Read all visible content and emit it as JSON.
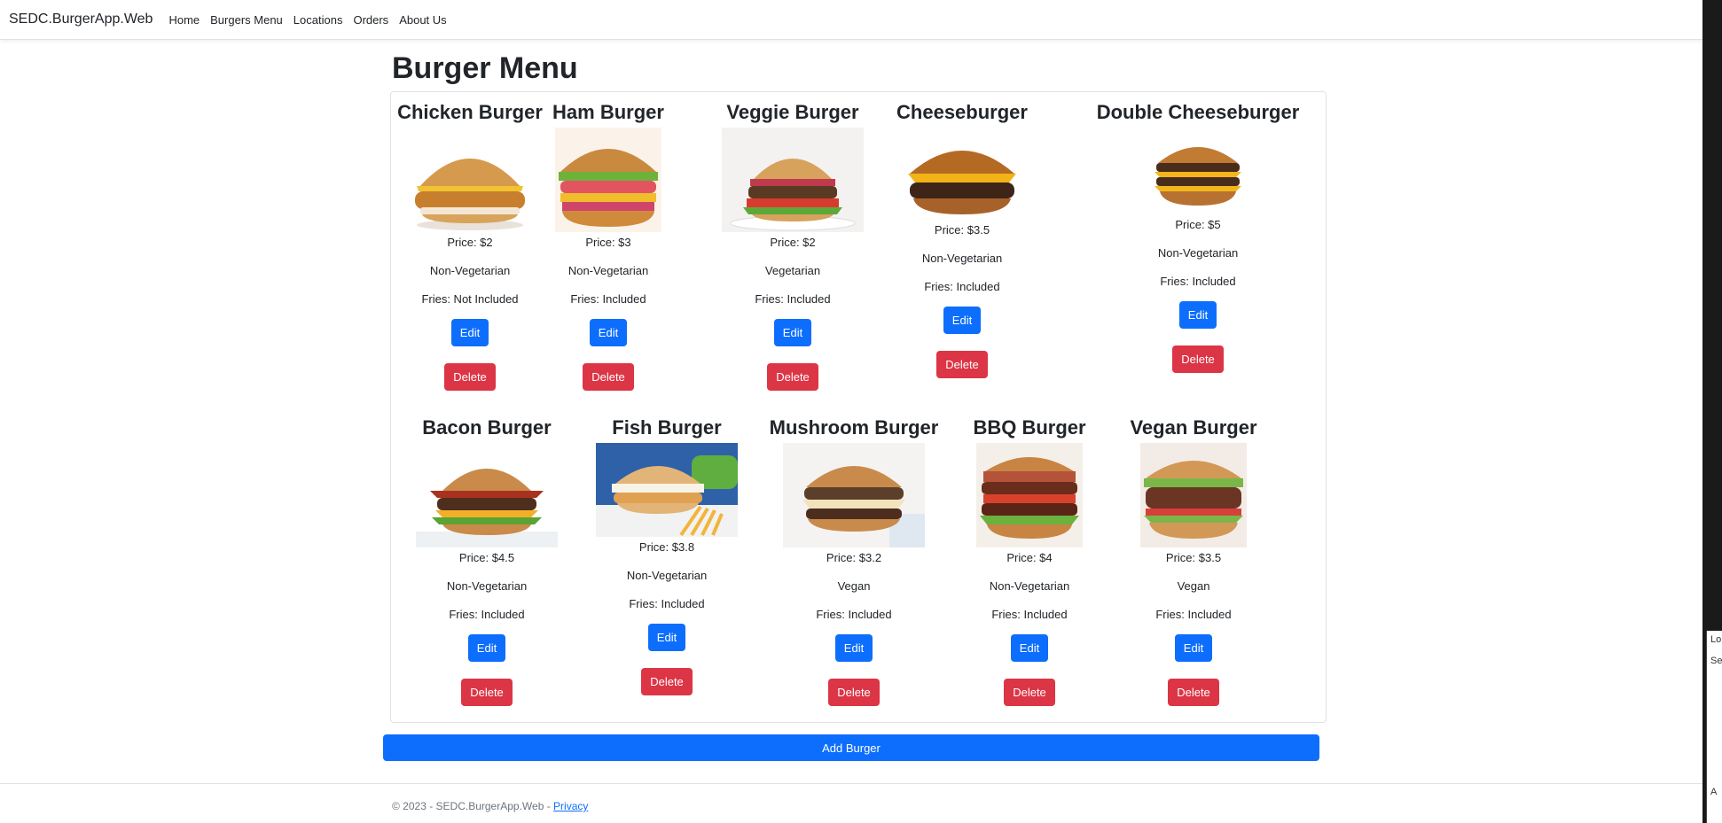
{
  "navbar": {
    "brand": "SEDC.BurgerApp.Web",
    "links": [
      "Home",
      "Burgers Menu",
      "Locations",
      "Orders",
      "About Us"
    ]
  },
  "page_title": "Burger Menu",
  "burgers": [
    {
      "name": "Chicken Burger",
      "price": "Price: $2",
      "type": "Non-Vegetarian",
      "fries": "Fries: Not Included",
      "edit": "Edit",
      "delete": "Delete"
    },
    {
      "name": "Ham Burger",
      "price": "Price: $3",
      "type": "Non-Vegetarian",
      "fries": "Fries: Included",
      "edit": "Edit",
      "delete": "Delete"
    },
    {
      "name": "Veggie Burger",
      "price": "Price: $2",
      "type": "Vegetarian",
      "fries": "Fries: Included",
      "edit": "Edit",
      "delete": "Delete"
    },
    {
      "name": "Cheeseburger",
      "price": "Price: $3.5",
      "type": "Non-Vegetarian",
      "fries": "Fries: Included",
      "edit": "Edit",
      "delete": "Delete"
    },
    {
      "name": "Double Cheeseburger",
      "price": "Price: $5",
      "type": "Non-Vegetarian",
      "fries": "Fries: Included",
      "edit": "Edit",
      "delete": "Delete"
    },
    {
      "name": "Bacon Burger",
      "price": "Price: $4.5",
      "type": "Non-Vegetarian",
      "fries": "Fries: Included",
      "edit": "Edit",
      "delete": "Delete"
    },
    {
      "name": "Fish Burger",
      "price": "Price: $3.8",
      "type": "Non-Vegetarian",
      "fries": "Fries: Included",
      "edit": "Edit",
      "delete": "Delete"
    },
    {
      "name": "Mushroom Burger",
      "price": "Price: $3.2",
      "type": "Vegan",
      "fries": "Fries: Included",
      "edit": "Edit",
      "delete": "Delete"
    },
    {
      "name": "BBQ Burger",
      "price": "Price: $4",
      "type": "Non-Vegetarian",
      "fries": "Fries: Included",
      "edit": "Edit",
      "delete": "Delete"
    },
    {
      "name": "Vegan Burger",
      "price": "Price: $3.5",
      "type": "Vegan",
      "fries": "Fries: Included",
      "edit": "Edit",
      "delete": "Delete"
    }
  ],
  "add_button": "Add Burger",
  "footer": {
    "text": "© 2023 - SEDC.BurgerApp.Web - ",
    "privacy": "Privacy"
  },
  "side": {
    "a": "Lo",
    "b": "Se",
    "c": "A"
  }
}
